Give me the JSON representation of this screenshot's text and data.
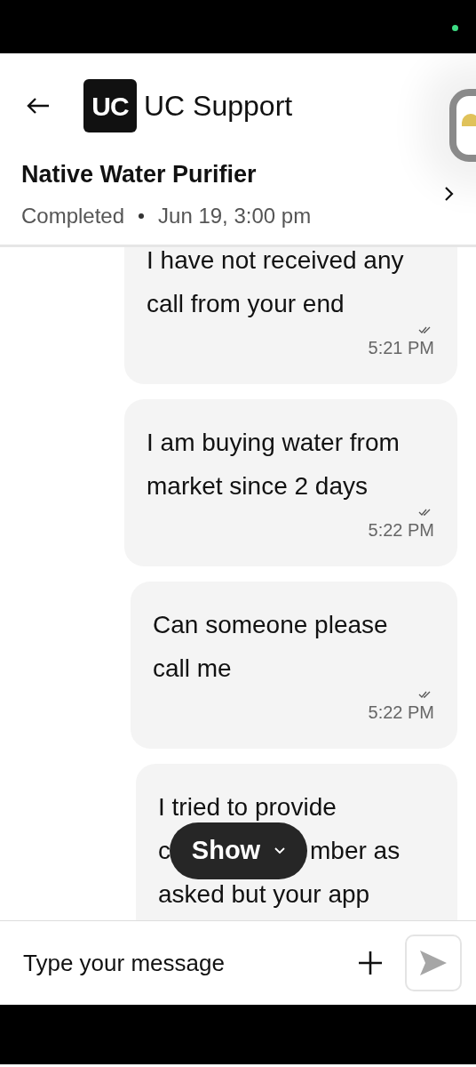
{
  "header": {
    "title": "UC Support",
    "logo": "UC"
  },
  "booking": {
    "title": "Native Water Purifier",
    "status": "Completed",
    "datetime": "Jun 19, 3:00 pm"
  },
  "messages": [
    {
      "lines": [
        "I have not received any",
        "call from your end"
      ],
      "time": "5:21 PM",
      "read": true
    },
    {
      "lines": [
        "I am buying water from",
        "market since 2 days"
      ],
      "time": "5:22 PM",
      "read": true
    },
    {
      "lines": [
        "Can someone please",
        "call me"
      ],
      "time": "5:22 PM",
      "read": true
    },
    {
      "lines": [
        "I tried to provide",
        [
          "c",
          "mber as"
        ],
        "asked but your app"
      ]
    }
  ],
  "show_button": {
    "label": "Show"
  },
  "composer": {
    "placeholder": "Type your message"
  }
}
